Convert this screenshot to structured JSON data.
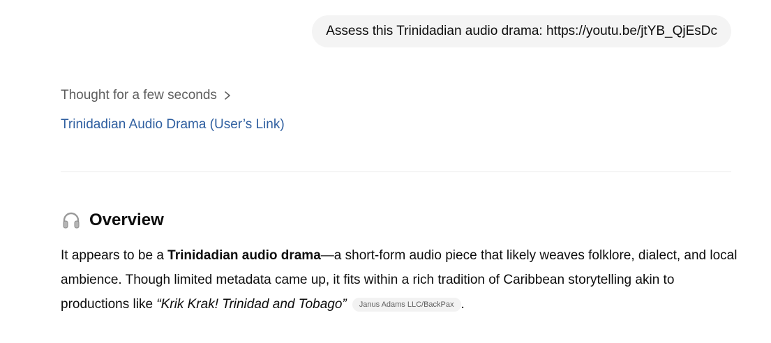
{
  "user_message": {
    "text": "Assess this Trinidadian audio drama: https://youtu.be/jtYB_QjEsDc"
  },
  "reasoning": {
    "label": "Thought for a few seconds",
    "icon": "chevron-right-icon"
  },
  "source": {
    "link_text": "Trinidadian Audio Drama (User’s Link)"
  },
  "response": {
    "heading_icon": "headphones-icon",
    "heading": "Overview",
    "p1_start": "It appears to be a ",
    "p1_bold": "Trinidadian audio drama",
    "p1_rest": "—a short-form audio piece that likely weaves folklore, dialect, and local ambience. Though limited metadata came up, it fits within a rich tradition of Caribbean storytelling akin to productions like ",
    "p1_italic": "“Krik Krak! Trinidad and Tobago”",
    "citation": "Janus Adams LLC/BackPax",
    "p1_end": "."
  },
  "colors": {
    "link": "#2f5fa0",
    "bubble_bg": "#f4f4f4",
    "muted_text": "#5d5d5d"
  }
}
